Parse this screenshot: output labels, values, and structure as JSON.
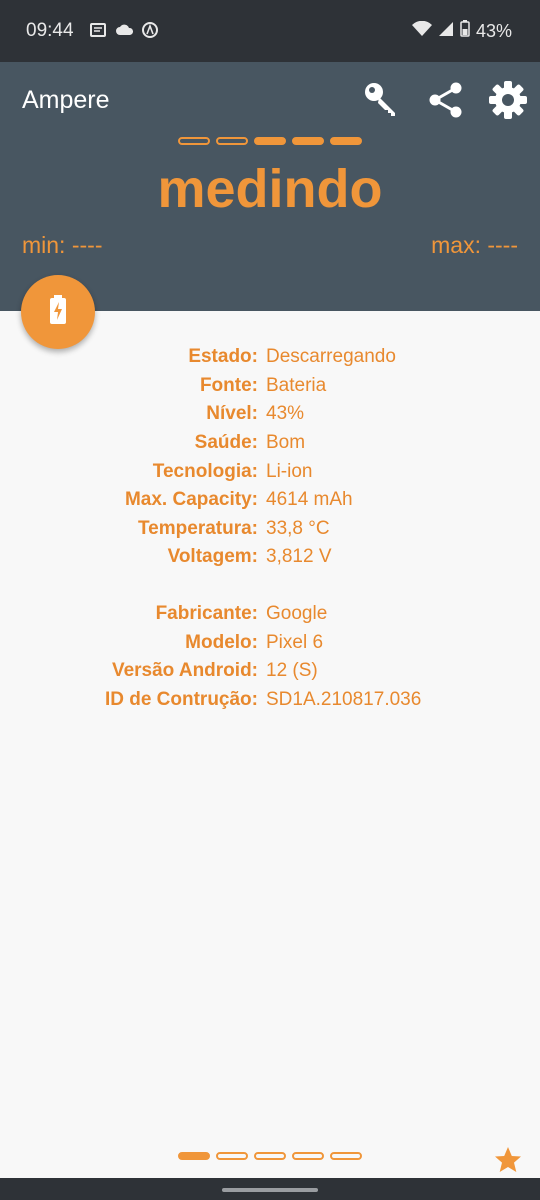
{
  "status_bar": {
    "time": "09:44",
    "battery_percent": "43%"
  },
  "header": {
    "title": "Ampere",
    "status_text": "medindo",
    "min_label": "min: ----",
    "max_label": "max: ----",
    "progress_steps_filled": [
      false,
      false,
      true,
      true,
      true
    ]
  },
  "info": {
    "rows": [
      {
        "label": "Estado:",
        "value": "Descarregando"
      },
      {
        "label": "Fonte:",
        "value": "Bateria"
      },
      {
        "label": "Nível:",
        "value": "43%"
      },
      {
        "label": "Saúde:",
        "value": "Bom"
      },
      {
        "label": "Tecnologia:",
        "value": "Li-ion"
      },
      {
        "label": "Max. Capacity:",
        "value": "4614 mAh"
      },
      {
        "label": "Temperatura:",
        "value": "33,8 °C"
      },
      {
        "label": "Voltagem:",
        "value": "3,812 V"
      }
    ],
    "device_rows": [
      {
        "label": "Fabricante:",
        "value": "Google"
      },
      {
        "label": "Modelo:",
        "value": "Pixel 6"
      },
      {
        "label": "Versão Android:",
        "value": "12 (S)"
      },
      {
        "label": "ID de Contrução:",
        "value": "SD1A.210817.036"
      }
    ]
  },
  "page_indicator": {
    "current_page": 1,
    "total_pages": 5
  },
  "colors": {
    "accent": "#f0963a",
    "header_bg": "#485661",
    "status_bar_bg": "#2e3237"
  },
  "icons": {
    "key": "key-icon",
    "share": "share-icon",
    "settings": "gear-icon",
    "fab": "battery-charging-icon",
    "rate": "star-icon"
  }
}
